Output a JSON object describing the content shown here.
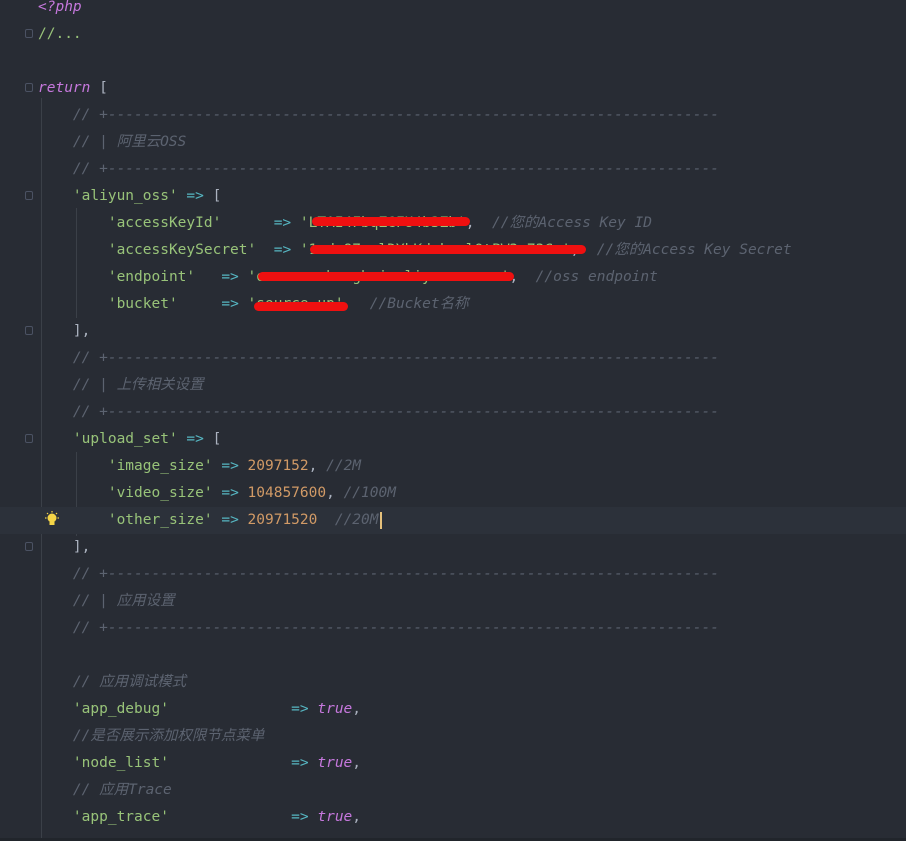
{
  "editor": {
    "language": "php",
    "cursor_line_index": 19,
    "lines": [
      [
        {
          "t": "<?php",
          "c": "kw"
        }
      ],
      [
        {
          "t": "//...",
          "c": "str"
        }
      ],
      [],
      [
        {
          "t": "return",
          "c": "kw"
        },
        {
          "t": " [",
          "c": "punc"
        }
      ],
      [
        {
          "t": "    // +----------------------------------------------------------------------",
          "c": "cm"
        }
      ],
      [
        {
          "t": "    // | 阿里云OSS",
          "c": "cm"
        }
      ],
      [
        {
          "t": "    // +----------------------------------------------------------------------",
          "c": "cm"
        }
      ],
      [
        {
          "t": "    'aliyun_oss'",
          "c": "str"
        },
        {
          "t": " => ",
          "c": "op"
        },
        {
          "t": "[",
          "c": "punc"
        }
      ],
      [
        {
          "t": "        'accessKeyId'",
          "c": "str"
        },
        {
          "t": "      => ",
          "c": "op"
        },
        {
          "t": "'LTAI4FbqZGFU4b3Zb'",
          "c": "str"
        },
        {
          "t": ",  ",
          "c": "punc"
        },
        {
          "t": "//您的Access Key ID",
          "c": "cm"
        }
      ],
      [
        {
          "t": "        'accessKeySecret'",
          "c": "str"
        },
        {
          "t": "  => ",
          "c": "op"
        },
        {
          "t": "'1xdc87xalDYbKdzkwelOtPW3x73Cu'",
          "c": "str"
        },
        {
          "t": ",  ",
          "c": "punc"
        },
        {
          "t": "//您的Access Key Secret",
          "c": "cm"
        }
      ],
      [
        {
          "t": "        'endpoint'",
          "c": "str"
        },
        {
          "t": "   => ",
          "c": "op"
        },
        {
          "t": "'oss-cn-shanghai.aliyuncs.com'",
          "c": "str"
        },
        {
          "t": ",  ",
          "c": "punc"
        },
        {
          "t": "//oss endpoint",
          "c": "cm"
        }
      ],
      [
        {
          "t": "        'bucket'",
          "c": "str"
        },
        {
          "t": "     => ",
          "c": "op"
        },
        {
          "t": "'source-up'",
          "c": "str"
        },
        {
          "t": "   ",
          "c": "punc"
        },
        {
          "t": "//Bucket名称",
          "c": "cm"
        }
      ],
      [
        {
          "t": "    ],",
          "c": "punc"
        }
      ],
      [
        {
          "t": "    // +----------------------------------------------------------------------",
          "c": "cm"
        }
      ],
      [
        {
          "t": "    // | 上传相关设置",
          "c": "cm"
        }
      ],
      [
        {
          "t": "    // +----------------------------------------------------------------------",
          "c": "cm"
        }
      ],
      [
        {
          "t": "    'upload_set'",
          "c": "str"
        },
        {
          "t": " => ",
          "c": "op"
        },
        {
          "t": "[",
          "c": "punc"
        }
      ],
      [
        {
          "t": "        'image_size'",
          "c": "str"
        },
        {
          "t": " => ",
          "c": "op"
        },
        {
          "t": "2097152",
          "c": "num"
        },
        {
          "t": ", ",
          "c": "punc"
        },
        {
          "t": "//2M",
          "c": "cm"
        }
      ],
      [
        {
          "t": "        'video_size'",
          "c": "str"
        },
        {
          "t": " => ",
          "c": "op"
        },
        {
          "t": "104857600",
          "c": "num"
        },
        {
          "t": ", ",
          "c": "punc"
        },
        {
          "t": "//100M",
          "c": "cm"
        }
      ],
      [
        {
          "t": "        'other_size'",
          "c": "str"
        },
        {
          "t": " => ",
          "c": "op"
        },
        {
          "t": "20971520",
          "c": "num"
        },
        {
          "t": "  ",
          "c": "punc"
        },
        {
          "t": "//20M",
          "c": "cm"
        }
      ],
      [
        {
          "t": "    ],",
          "c": "punc"
        }
      ],
      [
        {
          "t": "    // +----------------------------------------------------------------------",
          "c": "cm"
        }
      ],
      [
        {
          "t": "    // | 应用设置",
          "c": "cm"
        }
      ],
      [
        {
          "t": "    // +----------------------------------------------------------------------",
          "c": "cm"
        }
      ],
      [],
      [
        {
          "t": "    // 应用调试模式",
          "c": "cm"
        }
      ],
      [
        {
          "t": "    'app_debug'",
          "c": "str"
        },
        {
          "t": "              => ",
          "c": "op"
        },
        {
          "t": "true",
          "c": "kw"
        },
        {
          "t": ",",
          "c": "punc"
        }
      ],
      [
        {
          "t": "    //是否展示添加权限节点菜单",
          "c": "cm"
        }
      ],
      [
        {
          "t": "    'node_list'",
          "c": "str"
        },
        {
          "t": "              => ",
          "c": "op"
        },
        {
          "t": "true",
          "c": "kw"
        },
        {
          "t": ",",
          "c": "punc"
        }
      ],
      [
        {
          "t": "    // 应用Trace",
          "c": "cm"
        }
      ],
      [
        {
          "t": "    'app_trace'",
          "c": "str"
        },
        {
          "t": "              => ",
          "c": "op"
        },
        {
          "t": "true",
          "c": "kw"
        },
        {
          "t": ",",
          "c": "punc"
        }
      ]
    ]
  }
}
